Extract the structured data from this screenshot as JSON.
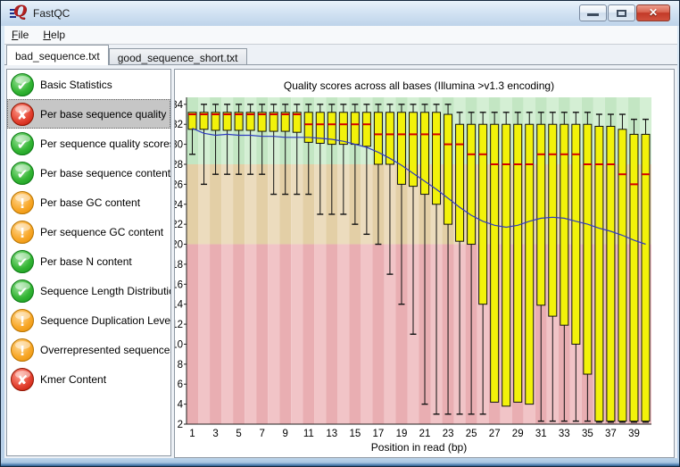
{
  "window": {
    "title": "FastQC",
    "app_icon": "fastqc-logo-q-with-speed-lines",
    "controls": {
      "minimize": "minimize-icon",
      "maximize": "maximize-icon",
      "close": "close-icon"
    }
  },
  "menu": {
    "items": [
      {
        "label": "File"
      },
      {
        "label": "Help"
      }
    ]
  },
  "tabs": [
    {
      "label": "bad_sequence.txt",
      "active": true
    },
    {
      "label": "good_sequence_short.txt",
      "active": false
    }
  ],
  "sidebar": {
    "items": [
      {
        "label": "Basic Statistics",
        "status": "pass",
        "selected": false
      },
      {
        "label": "Per base sequence quality",
        "status": "fail",
        "selected": true
      },
      {
        "label": "Per sequence quality scores",
        "status": "pass",
        "selected": false
      },
      {
        "label": "Per base sequence content",
        "status": "pass",
        "selected": false
      },
      {
        "label": "Per base GC content",
        "status": "warn",
        "selected": false
      },
      {
        "label": "Per sequence GC content",
        "status": "warn",
        "selected": false
      },
      {
        "label": "Per base N content",
        "status": "pass",
        "selected": false
      },
      {
        "label": "Sequence Length Distribution",
        "status": "pass",
        "selected": false
      },
      {
        "label": "Sequence Duplication Levels",
        "status": "warn",
        "selected": false
      },
      {
        "label": "Overrepresented sequences",
        "status": "warn",
        "selected": false
      },
      {
        "label": "Kmer Content",
        "status": "fail",
        "selected": false
      }
    ],
    "status_icons": {
      "pass": "green-check-icon",
      "fail": "red-cross-icon",
      "warn": "orange-warning-icon"
    }
  },
  "chart_data": {
    "type": "boxplot",
    "title": "Quality scores across all bases (Illumina >v1.3 encoding)",
    "xlabel": "Position in read (bp)",
    "ylim": [
      2,
      34.7
    ],
    "y_ticks": [
      2,
      4,
      6,
      8,
      10,
      12,
      14,
      16,
      18,
      20,
      22,
      24,
      26,
      28,
      30,
      32,
      34
    ],
    "x_tick_labels": [
      1,
      3,
      5,
      7,
      9,
      11,
      13,
      15,
      17,
      19,
      21,
      23,
      25,
      27,
      29,
      31,
      33,
      35,
      37,
      39
    ],
    "legend": "none",
    "grid": false,
    "bands": [
      {
        "from": 28,
        "to": 34.7,
        "meaning": "good quality",
        "colors": [
          "#c3e6c3",
          "#d4efd4"
        ]
      },
      {
        "from": 20,
        "to": 28,
        "meaning": "medium quality",
        "colors": [
          "#e3cfa6",
          "#ecdcbe"
        ]
      },
      {
        "from": 2,
        "to": 20,
        "meaning": "poor quality",
        "colors": [
          "#e9aeb2",
          "#f1c4c7"
        ]
      }
    ],
    "style": {
      "box_fill": "#f2f20a",
      "box_stroke": "#111111",
      "median_color": "#d40000",
      "mean_color": "#2e3bc0",
      "whisker_color": "#111111"
    },
    "boxes": [
      {
        "pos": 1,
        "wlow": 29,
        "q1": 31.5,
        "median": 33,
        "q3": 33.2,
        "whigh": 33.2,
        "mean": 31.6
      },
      {
        "pos": 2,
        "wlow": 26,
        "q1": 31.5,
        "median": 33,
        "q3": 33.2,
        "whigh": 34,
        "mean": 31.1
      },
      {
        "pos": 3,
        "wlow": 27,
        "q1": 31.4,
        "median": 33,
        "q3": 33.2,
        "whigh": 34,
        "mean": 30.9
      },
      {
        "pos": 4,
        "wlow": 27,
        "q1": 31.4,
        "median": 33,
        "q3": 33.2,
        "whigh": 34,
        "mean": 31.0
      },
      {
        "pos": 5,
        "wlow": 27,
        "q1": 31.4,
        "median": 33,
        "q3": 33.2,
        "whigh": 34,
        "mean": 30.9
      },
      {
        "pos": 6,
        "wlow": 27,
        "q1": 31.4,
        "median": 33,
        "q3": 33.2,
        "whigh": 34,
        "mean": 30.9
      },
      {
        "pos": 7,
        "wlow": 27,
        "q1": 31.3,
        "median": 33,
        "q3": 33.2,
        "whigh": 34,
        "mean": 30.8
      },
      {
        "pos": 8,
        "wlow": 25,
        "q1": 31.3,
        "median": 33,
        "q3": 33.2,
        "whigh": 34,
        "mean": 30.8
      },
      {
        "pos": 9,
        "wlow": 25,
        "q1": 31.3,
        "median": 33,
        "q3": 33.2,
        "whigh": 34,
        "mean": 30.7
      },
      {
        "pos": 10,
        "wlow": 25,
        "q1": 31.2,
        "median": 33,
        "q3": 33.2,
        "whigh": 34,
        "mean": 30.7
      },
      {
        "pos": 11,
        "wlow": 25,
        "q1": 30.2,
        "median": 32,
        "q3": 33.2,
        "whigh": 34,
        "mean": 30.7
      },
      {
        "pos": 12,
        "wlow": 23,
        "q1": 30.1,
        "median": 32,
        "q3": 33.2,
        "whigh": 34,
        "mean": 30.6
      },
      {
        "pos": 13,
        "wlow": 23,
        "q1": 30.0,
        "median": 32,
        "q3": 33.2,
        "whigh": 34,
        "mean": 30.5
      },
      {
        "pos": 14,
        "wlow": 23,
        "q1": 30.0,
        "median": 32,
        "q3": 33.2,
        "whigh": 34,
        "mean": 30.3
      },
      {
        "pos": 15,
        "wlow": 22,
        "q1": 30.0,
        "median": 32,
        "q3": 33.2,
        "whigh": 34,
        "mean": 30.0
      },
      {
        "pos": 16,
        "wlow": 21,
        "q1": 29.8,
        "median": 32,
        "q3": 33.2,
        "whigh": 34,
        "mean": 29.7
      },
      {
        "pos": 17,
        "wlow": 20,
        "q1": 28.0,
        "median": 31,
        "q3": 33.2,
        "whigh": 34,
        "mean": 29.2
      },
      {
        "pos": 18,
        "wlow": 17,
        "q1": 28.0,
        "median": 31,
        "q3": 33.2,
        "whigh": 34,
        "mean": 28.6
      },
      {
        "pos": 19,
        "wlow": 14,
        "q1": 26.0,
        "median": 31,
        "q3": 33.2,
        "whigh": 34,
        "mean": 27.9
      },
      {
        "pos": 20,
        "wlow": 11,
        "q1": 25.8,
        "median": 31,
        "q3": 33.2,
        "whigh": 34,
        "mean": 27.1
      },
      {
        "pos": 21,
        "wlow": 4,
        "q1": 25.0,
        "median": 31,
        "q3": 33.2,
        "whigh": 34,
        "mean": 26.3
      },
      {
        "pos": 22,
        "wlow": 3,
        "q1": 24.0,
        "median": 31,
        "q3": 33.2,
        "whigh": 34,
        "mean": 25.5
      },
      {
        "pos": 23,
        "wlow": 3,
        "q1": 22.0,
        "median": 30,
        "q3": 33.0,
        "whigh": 34,
        "mean": 24.6
      },
      {
        "pos": 24,
        "wlow": 3,
        "q1": 20.3,
        "median": 30,
        "q3": 32.0,
        "whigh": 33.2,
        "mean": 23.7
      },
      {
        "pos": 25,
        "wlow": 3,
        "q1": 20.0,
        "median": 29,
        "q3": 32.0,
        "whigh": 33.2,
        "mean": 22.9
      },
      {
        "pos": 26,
        "wlow": 3,
        "q1": 14.0,
        "median": 29,
        "q3": 32.0,
        "whigh": 33.2,
        "mean": 22.3
      },
      {
        "pos": 27,
        "wlow": 4.2,
        "q1": 4.2,
        "median": 28,
        "q3": 32.0,
        "whigh": 33.2,
        "mean": 21.9
      },
      {
        "pos": 28,
        "wlow": 3.8,
        "q1": 3.8,
        "median": 28,
        "q3": 32.0,
        "whigh": 33.2,
        "mean": 21.7
      },
      {
        "pos": 29,
        "wlow": 4.2,
        "q1": 4.2,
        "median": 28,
        "q3": 32.0,
        "whigh": 33.2,
        "mean": 21.9
      },
      {
        "pos": 30,
        "wlow": 4.0,
        "q1": 4.0,
        "median": 28,
        "q3": 32.0,
        "whigh": 33.2,
        "mean": 22.3
      },
      {
        "pos": 31,
        "wlow": 2.3,
        "q1": 13.9,
        "median": 29,
        "q3": 32.0,
        "whigh": 33.2,
        "mean": 22.6
      },
      {
        "pos": 32,
        "wlow": 2.3,
        "q1": 12.8,
        "median": 29,
        "q3": 32.0,
        "whigh": 33.2,
        "mean": 22.7
      },
      {
        "pos": 33,
        "wlow": 2.3,
        "q1": 11.9,
        "median": 29,
        "q3": 32.0,
        "whigh": 33.2,
        "mean": 22.6
      },
      {
        "pos": 34,
        "wlow": 2.3,
        "q1": 10.0,
        "median": 29,
        "q3": 32.0,
        "whigh": 33.2,
        "mean": 22.3
      },
      {
        "pos": 35,
        "wlow": 2.3,
        "q1": 7.0,
        "median": 28,
        "q3": 32.0,
        "whigh": 33.2,
        "mean": 22.0
      },
      {
        "pos": 36,
        "wlow": 2.2,
        "q1": 2.3,
        "median": 28,
        "q3": 31.8,
        "whigh": 33.0,
        "mean": 21.6
      },
      {
        "pos": 37,
        "wlow": 2.2,
        "q1": 2.3,
        "median": 28,
        "q3": 31.8,
        "whigh": 33.0,
        "mean": 21.3
      },
      {
        "pos": 38,
        "wlow": 2.2,
        "q1": 2.3,
        "median": 27,
        "q3": 31.5,
        "whigh": 33.0,
        "mean": 20.9
      },
      {
        "pos": 39,
        "wlow": 2.2,
        "q1": 2.3,
        "median": 26,
        "q3": 31.0,
        "whigh": 32.5,
        "mean": 20.4
      },
      {
        "pos": 40,
        "wlow": 2.2,
        "q1": 2.3,
        "median": 27,
        "q3": 31.0,
        "whigh": 32.5,
        "mean": 20.0
      }
    ]
  }
}
